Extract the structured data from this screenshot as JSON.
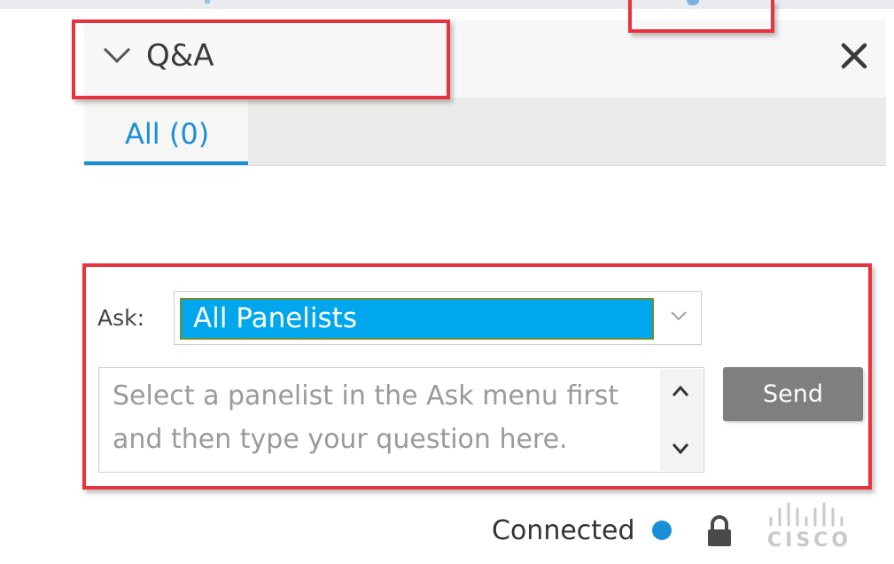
{
  "panel": {
    "title": "Q&A"
  },
  "tabs": [
    {
      "label": "All (0)",
      "active": true
    }
  ],
  "ask": {
    "label": "Ask:",
    "selected": "All Panelists",
    "question_placeholder": "Select a panelist in the Ask menu first and then type your question here.",
    "send_label": "Send"
  },
  "status": {
    "text": "Connected",
    "dot_color": "#1b8ed8"
  },
  "brand": {
    "logo_text": "CISCO"
  },
  "icons": [
    "chevron-down-icon",
    "close-icon",
    "scroll-up-icon",
    "scroll-down-icon",
    "lock-icon",
    "cisco-logo"
  ],
  "colors": {
    "accent": "#1b8ed8",
    "highlight": "#e8333f",
    "selected_bg": "#00a7ed",
    "send_bg": "#7f7f7f"
  }
}
